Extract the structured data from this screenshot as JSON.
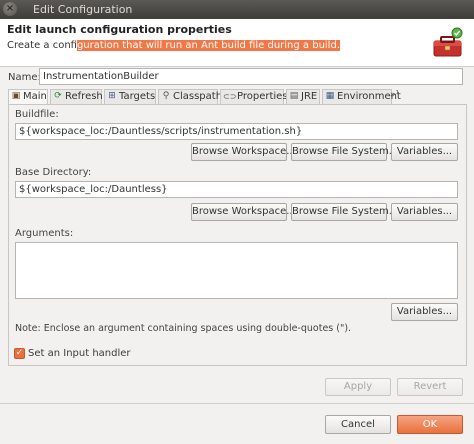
{
  "window": {
    "title": "Edit Configuration",
    "close_glyph": "×"
  },
  "header": {
    "title": "Edit launch configuration properties",
    "desc_before": "Create a confi",
    "desc_highlight": "guration that will run an Ant build file during a build."
  },
  "name": {
    "label": "Name:",
    "value": "InstrumentationBuilder"
  },
  "tabs": [
    {
      "label": "Main",
      "icon": "ant-icon",
      "glyph": "▣"
    },
    {
      "label": "Refresh",
      "icon": "refresh-icon",
      "glyph": "⟳"
    },
    {
      "label": "Targets",
      "icon": "targets-icon",
      "glyph": "⊞"
    },
    {
      "label": "Classpath",
      "icon": "classpath-icon",
      "glyph": "⚲"
    },
    {
      "label": "Properties",
      "icon": "properties-icon",
      "glyph": "⊂⊃"
    },
    {
      "label": "JRE",
      "icon": "jre-icon",
      "glyph": "▤"
    },
    {
      "label": "Environment",
      "icon": "environment-icon",
      "glyph": "▦"
    }
  ],
  "tabs_overflow": "»¹",
  "buildfile": {
    "label": "Buildfile:",
    "value": "${workspace_loc:/Dauntless/scripts/instrumentation.sh}"
  },
  "base_dir": {
    "label": "Base Directory:",
    "value": "${workspace_loc:/Dauntless}"
  },
  "arguments": {
    "label": "Arguments:",
    "value": "",
    "note": "Note: Enclose an argument containing spaces using double-quotes (\")."
  },
  "buttons": {
    "browse_workspace": "Browse Workspace...",
    "browse_filesystem": "Browse File System...",
    "variables": "Variables...",
    "apply": "Apply",
    "revert": "Revert",
    "cancel": "Cancel",
    "ok": "OK"
  },
  "input_handler": {
    "label": "Set an Input handler",
    "checked": true
  },
  "colors": {
    "accent": "#e9703f",
    "highlight": "#f07746"
  }
}
